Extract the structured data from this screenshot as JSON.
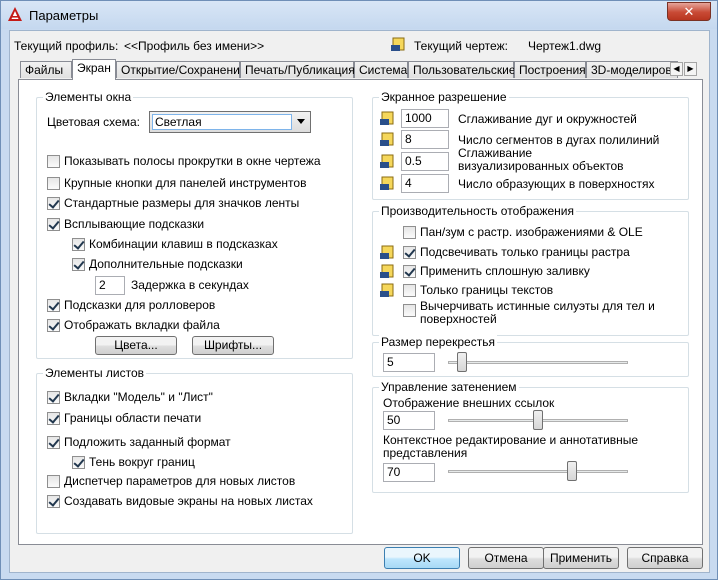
{
  "window": {
    "title": "Параметры",
    "close_symbol": "✕"
  },
  "profile": {
    "label": "Текущий профиль:",
    "value": "<<Профиль без имени>>"
  },
  "drawing": {
    "label": "Текущий чертеж:",
    "value": "Чертеж1.dwg",
    "icon": "drawing-icon"
  },
  "tabs": [
    "Файлы",
    "Экран",
    "Открытие/Сохранение",
    "Печать/Публикация",
    "Система",
    "Пользовательские",
    "Построения",
    "3D-моделирова"
  ],
  "active_tab": "Экран",
  "window_elements": {
    "title": "Элементы окна",
    "color_scheme_label": "Цветовая схема:",
    "color_scheme_value": "Светлая",
    "scrollbars": "Показывать полосы прокрутки в окне чертежа",
    "large_buttons": "Крупные кнопки для панелей инструментов",
    "ribbon_icons": "Стандартные размеры для значков ленты",
    "tooltips": "Всплывающие подсказки",
    "shortcut_keys": "Комбинации клавиш в подсказках",
    "extended_tooltips": "Дополнительные подсказки",
    "delay_value": "2",
    "delay_label": "Задержка в секундах",
    "rollover": "Подсказки для ролловеров",
    "file_tabs": "Отображать вкладки файла",
    "colors_button": "Цвета...",
    "fonts_button": "Шрифты..."
  },
  "layout_elements": {
    "title": "Элементы листов",
    "model_tabs": "Вкладки \"Модель\" и \"Лист\"",
    "print_area": "Границы области печати",
    "paper_background": "Подложить заданный формат",
    "paper_shadow": "Тень вокруг границ",
    "page_setup": "Диспетчер параметров для новых листов",
    "viewports": "Создавать видовые экраны на новых листах"
  },
  "display_resolution": {
    "title": "Экранное разрешение",
    "arc_smoothness": {
      "value": "1000",
      "label": "Сглаживание дуг и окружностей"
    },
    "polyline_segments": {
      "value": "8",
      "label": "Число сегментов в дугах полилиний"
    },
    "rendered_smoothness": {
      "value": "0.5",
      "label": "Сглаживание визуализированных объектов"
    },
    "contour_lines": {
      "value": "4",
      "label": "Число образующих в поверхностях"
    }
  },
  "display_performance": {
    "title": "Производительность отображения",
    "pan_zoom": "Пан/зум с растр. изображениями & OLE",
    "raster_frame": "Подсвечивать только границы растра",
    "solid_fill": "Применить сплошную заливку",
    "text_frame": "Только границы текстов",
    "silhouettes": "Вычерчивать истинные силуэты для тел и поверхностей"
  },
  "crosshair": {
    "title": "Размер перекрестья",
    "value": "5",
    "level": 0.05
  },
  "fade": {
    "title": "Управление затенением",
    "xref_label": "Отображение внешних ссылок",
    "xref_value": "50",
    "xref_level": 0.5,
    "inplace_label": "Контекстное редактирование и аннотативные представления",
    "inplace_value": "70",
    "inplace_level": 0.7
  },
  "buttons": {
    "ok": "OK",
    "cancel": "Отмена",
    "apply": "Применить",
    "help": "Справка"
  },
  "colors": {
    "accent_blue": "#3c7fb1",
    "close_red": "#c84a35"
  }
}
